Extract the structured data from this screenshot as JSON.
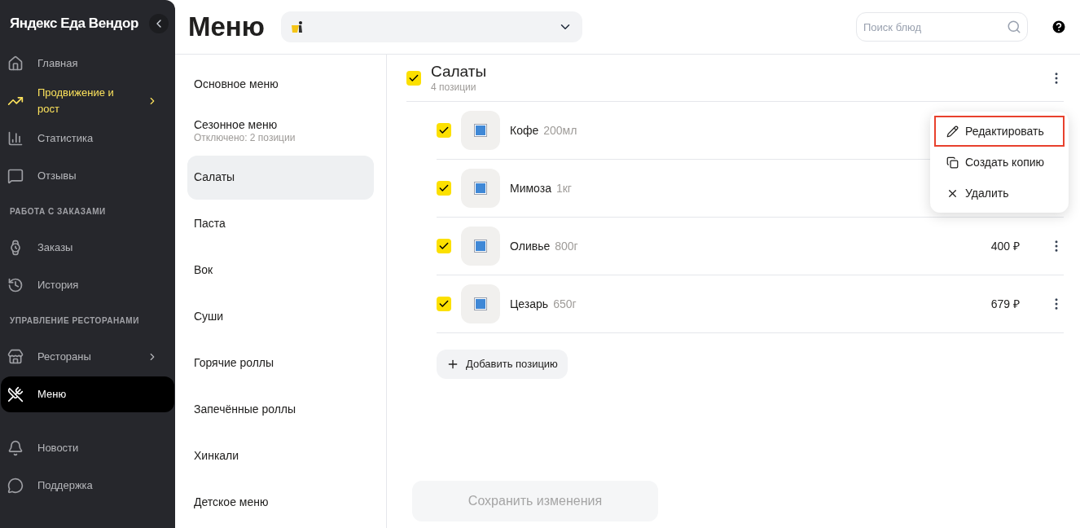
{
  "sidebar": {
    "brand": "Яндекс Еда Вендор",
    "groups": [
      {
        "items": [
          {
            "label": "Главная",
            "selected": false,
            "highlighted": false,
            "has_submenu": false
          },
          {
            "label": "Продвижение и рост",
            "selected": false,
            "highlighted": true,
            "has_submenu": true
          },
          {
            "label": "Статистика",
            "selected": false,
            "highlighted": false,
            "has_submenu": false
          },
          {
            "label": "Отзывы",
            "selected": false,
            "highlighted": false,
            "has_submenu": false
          }
        ]
      },
      {
        "title": "РАБОТА С ЗАКАЗАМИ",
        "items": [
          {
            "label": "Заказы",
            "selected": false,
            "highlighted": false,
            "has_submenu": false
          },
          {
            "label": "История",
            "selected": false,
            "highlighted": false,
            "has_submenu": false
          }
        ]
      },
      {
        "title": "УПРАВЛЕНИЕ РЕСТОРАНАМИ",
        "items": [
          {
            "label": "Рестораны",
            "selected": false,
            "highlighted": false,
            "has_submenu": true
          },
          {
            "label": "Меню",
            "selected": true,
            "highlighted": false,
            "has_submenu": false
          }
        ]
      },
      {
        "items": [
          {
            "label": "Новости",
            "selected": false,
            "highlighted": false,
            "has_submenu": false
          },
          {
            "label": "Поддержка",
            "selected": false,
            "highlighted": false,
            "has_submenu": false
          }
        ]
      }
    ]
  },
  "header": {
    "title": "Меню",
    "search": {
      "placeholder": "Поиск блюд"
    }
  },
  "categories": [
    {
      "label": "Основное меню",
      "selected": false
    },
    {
      "label": "Сезонное меню",
      "note": "Отключено: 2 позиции",
      "selected": false
    },
    {
      "label": "Салаты",
      "selected": true
    },
    {
      "label": "Паста",
      "selected": false
    },
    {
      "label": "Вок",
      "selected": false
    },
    {
      "label": "Суши",
      "selected": false
    },
    {
      "label": "Горячие роллы",
      "selected": false
    },
    {
      "label": "Запечённые роллы",
      "selected": false
    },
    {
      "label": "Хинкали",
      "selected": false
    },
    {
      "label": "Детское меню",
      "selected": false
    }
  ],
  "section": {
    "title": "Салаты",
    "count": "4 позиции",
    "checked": true
  },
  "items": [
    {
      "name": "Кофе",
      "weight": "200мл",
      "checked": true,
      "has_more": false
    },
    {
      "name": "Мимоза",
      "weight": "1кг",
      "checked": true,
      "has_more": false
    },
    {
      "name": "Оливье",
      "weight": "800г",
      "price": "400 ₽",
      "checked": true,
      "has_more": true
    },
    {
      "name": "Цезарь",
      "weight": "650г",
      "price": "679 ₽",
      "checked": true,
      "has_more": true
    }
  ],
  "add_button": "Добавить позицию",
  "context_menu": [
    {
      "label": "Редактировать",
      "kind": "edit",
      "highlighted": true
    },
    {
      "label": "Создать копию",
      "kind": "copy",
      "highlighted": false
    },
    {
      "label": "Удалить",
      "kind": "delete",
      "highlighted": false
    }
  ],
  "save_button": {
    "label": "Сохранить изменения",
    "disabled": true
  }
}
